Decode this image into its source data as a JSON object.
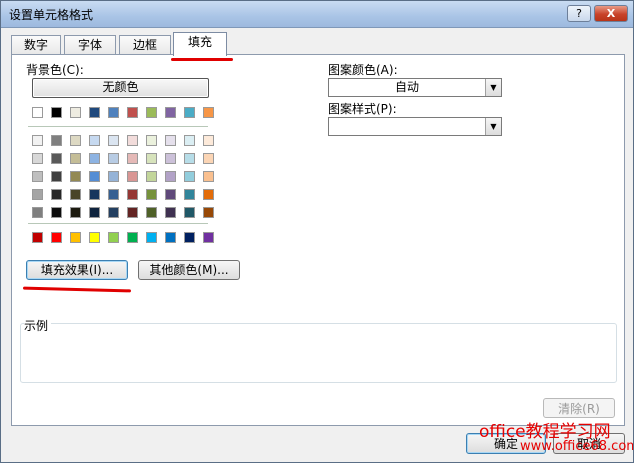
{
  "window": {
    "title": "设置单元格格式",
    "help": "?",
    "close": "X"
  },
  "tabs": [
    {
      "label": "数字"
    },
    {
      "label": "字体"
    },
    {
      "label": "边框"
    },
    {
      "label": "填充",
      "active": true
    }
  ],
  "fill": {
    "bg_label": "背景色(C):",
    "no_color": "无颜色",
    "palette_top": [
      "#ffffff",
      "#000000",
      "#eeece1",
      "#1f497d",
      "#4f81bd",
      "#c0504d",
      "#9bbb59",
      "#8064a2",
      "#4bacc6",
      "#f79646"
    ],
    "palette_shades": [
      [
        "#f2f2f2",
        "#7f7f7f",
        "#ddd9c3",
        "#c6d9f0",
        "#dbe5f1",
        "#f2dcdb",
        "#ebf1dd",
        "#e5e0ec",
        "#dbeef3",
        "#fdeada"
      ],
      [
        "#d8d8d8",
        "#595959",
        "#c4bd97",
        "#8db3e2",
        "#b8cce4",
        "#e5b9b7",
        "#d7e3bc",
        "#ccc1d9",
        "#b7dde8",
        "#fbd5b5"
      ],
      [
        "#bfbfbf",
        "#3f3f3f",
        "#938953",
        "#548dd4",
        "#95b3d7",
        "#d99694",
        "#c3d69b",
        "#b2a2c7",
        "#92cddc",
        "#fac08f"
      ],
      [
        "#a5a5a5",
        "#262626",
        "#494429",
        "#17365d",
        "#366092",
        "#953734",
        "#76923c",
        "#5f497a",
        "#31859b",
        "#e36c09"
      ],
      [
        "#7f7f7f",
        "#0c0c0c",
        "#1d1b10",
        "#0f243e",
        "#244061",
        "#632423",
        "#4f6128",
        "#3f3151",
        "#205867",
        "#974806"
      ]
    ],
    "palette_standard": [
      "#c00000",
      "#ff0000",
      "#ffc000",
      "#ffff00",
      "#92d050",
      "#00b050",
      "#00b0f0",
      "#0070c0",
      "#002060",
      "#7030a0"
    ],
    "fill_effects": "填充效果(I)...",
    "more_colors": "其他颜色(M)...",
    "pattern_color_label": "图案颜色(A):",
    "pattern_color_value": "自动",
    "pattern_style_label": "图案样式(P):",
    "pattern_style_value": "",
    "sample_label": "示例",
    "clear": "清除(R)"
  },
  "footer": {
    "ok": "确定",
    "cancel": "取消"
  },
  "watermark": {
    "line1": "office教程学习网",
    "line2": "www.office68.com"
  },
  "annotation_color": "#e00000"
}
